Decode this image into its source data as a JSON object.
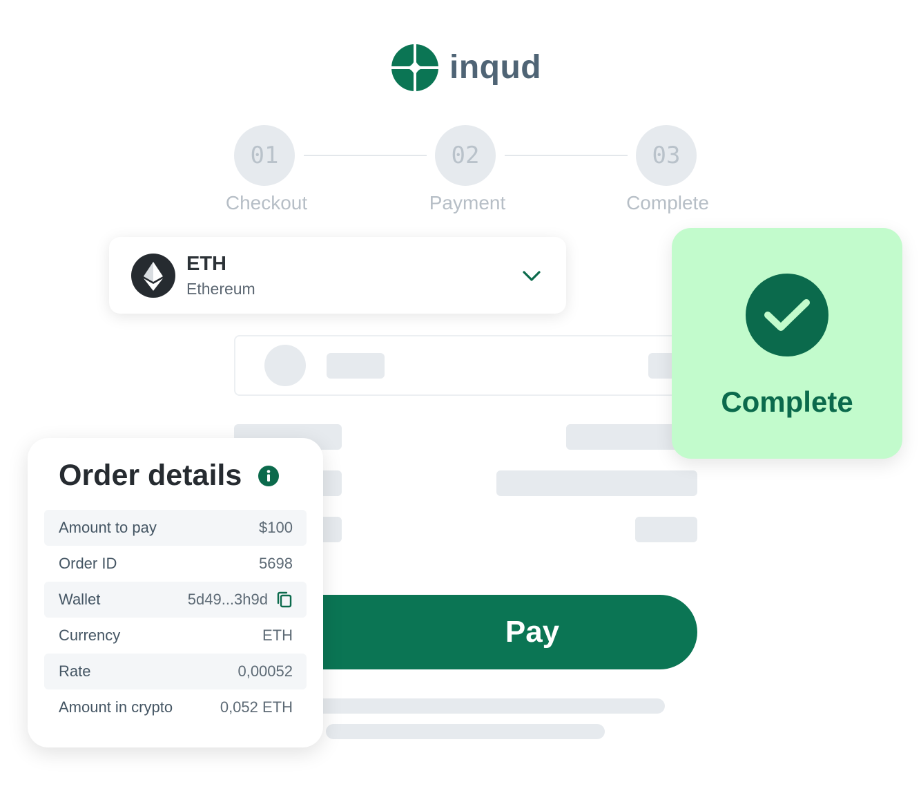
{
  "brand": {
    "name": "inqud",
    "color": "#0b7554"
  },
  "stepper": {
    "steps": [
      {
        "number": "01",
        "label": "Checkout"
      },
      {
        "number": "02",
        "label": "Payment"
      },
      {
        "number": "03",
        "label": "Complete"
      }
    ]
  },
  "currency_selector": {
    "code": "ETH",
    "name": "Ethereum",
    "icon": "ethereum-icon",
    "toggle_icon": "chevron-down-icon"
  },
  "pay_button": {
    "label": "Pay"
  },
  "complete_card": {
    "label": "Complete",
    "icon": "check-icon",
    "background": "#c2fbcc",
    "accent": "#0b6a4c"
  },
  "order_details": {
    "title": "Order details",
    "info_icon": "info-icon",
    "rows": [
      {
        "label": "Amount to pay",
        "value": "$100"
      },
      {
        "label": "Order ID",
        "value": "5698"
      },
      {
        "label": "Wallet",
        "value": "5d49...3h9d",
        "action_icon": "copy-icon"
      },
      {
        "label": "Currency",
        "value": "ETH"
      },
      {
        "label": "Rate",
        "value": "0,00052"
      },
      {
        "label": "Amount in crypto",
        "value": "0,052 ETH"
      }
    ]
  }
}
